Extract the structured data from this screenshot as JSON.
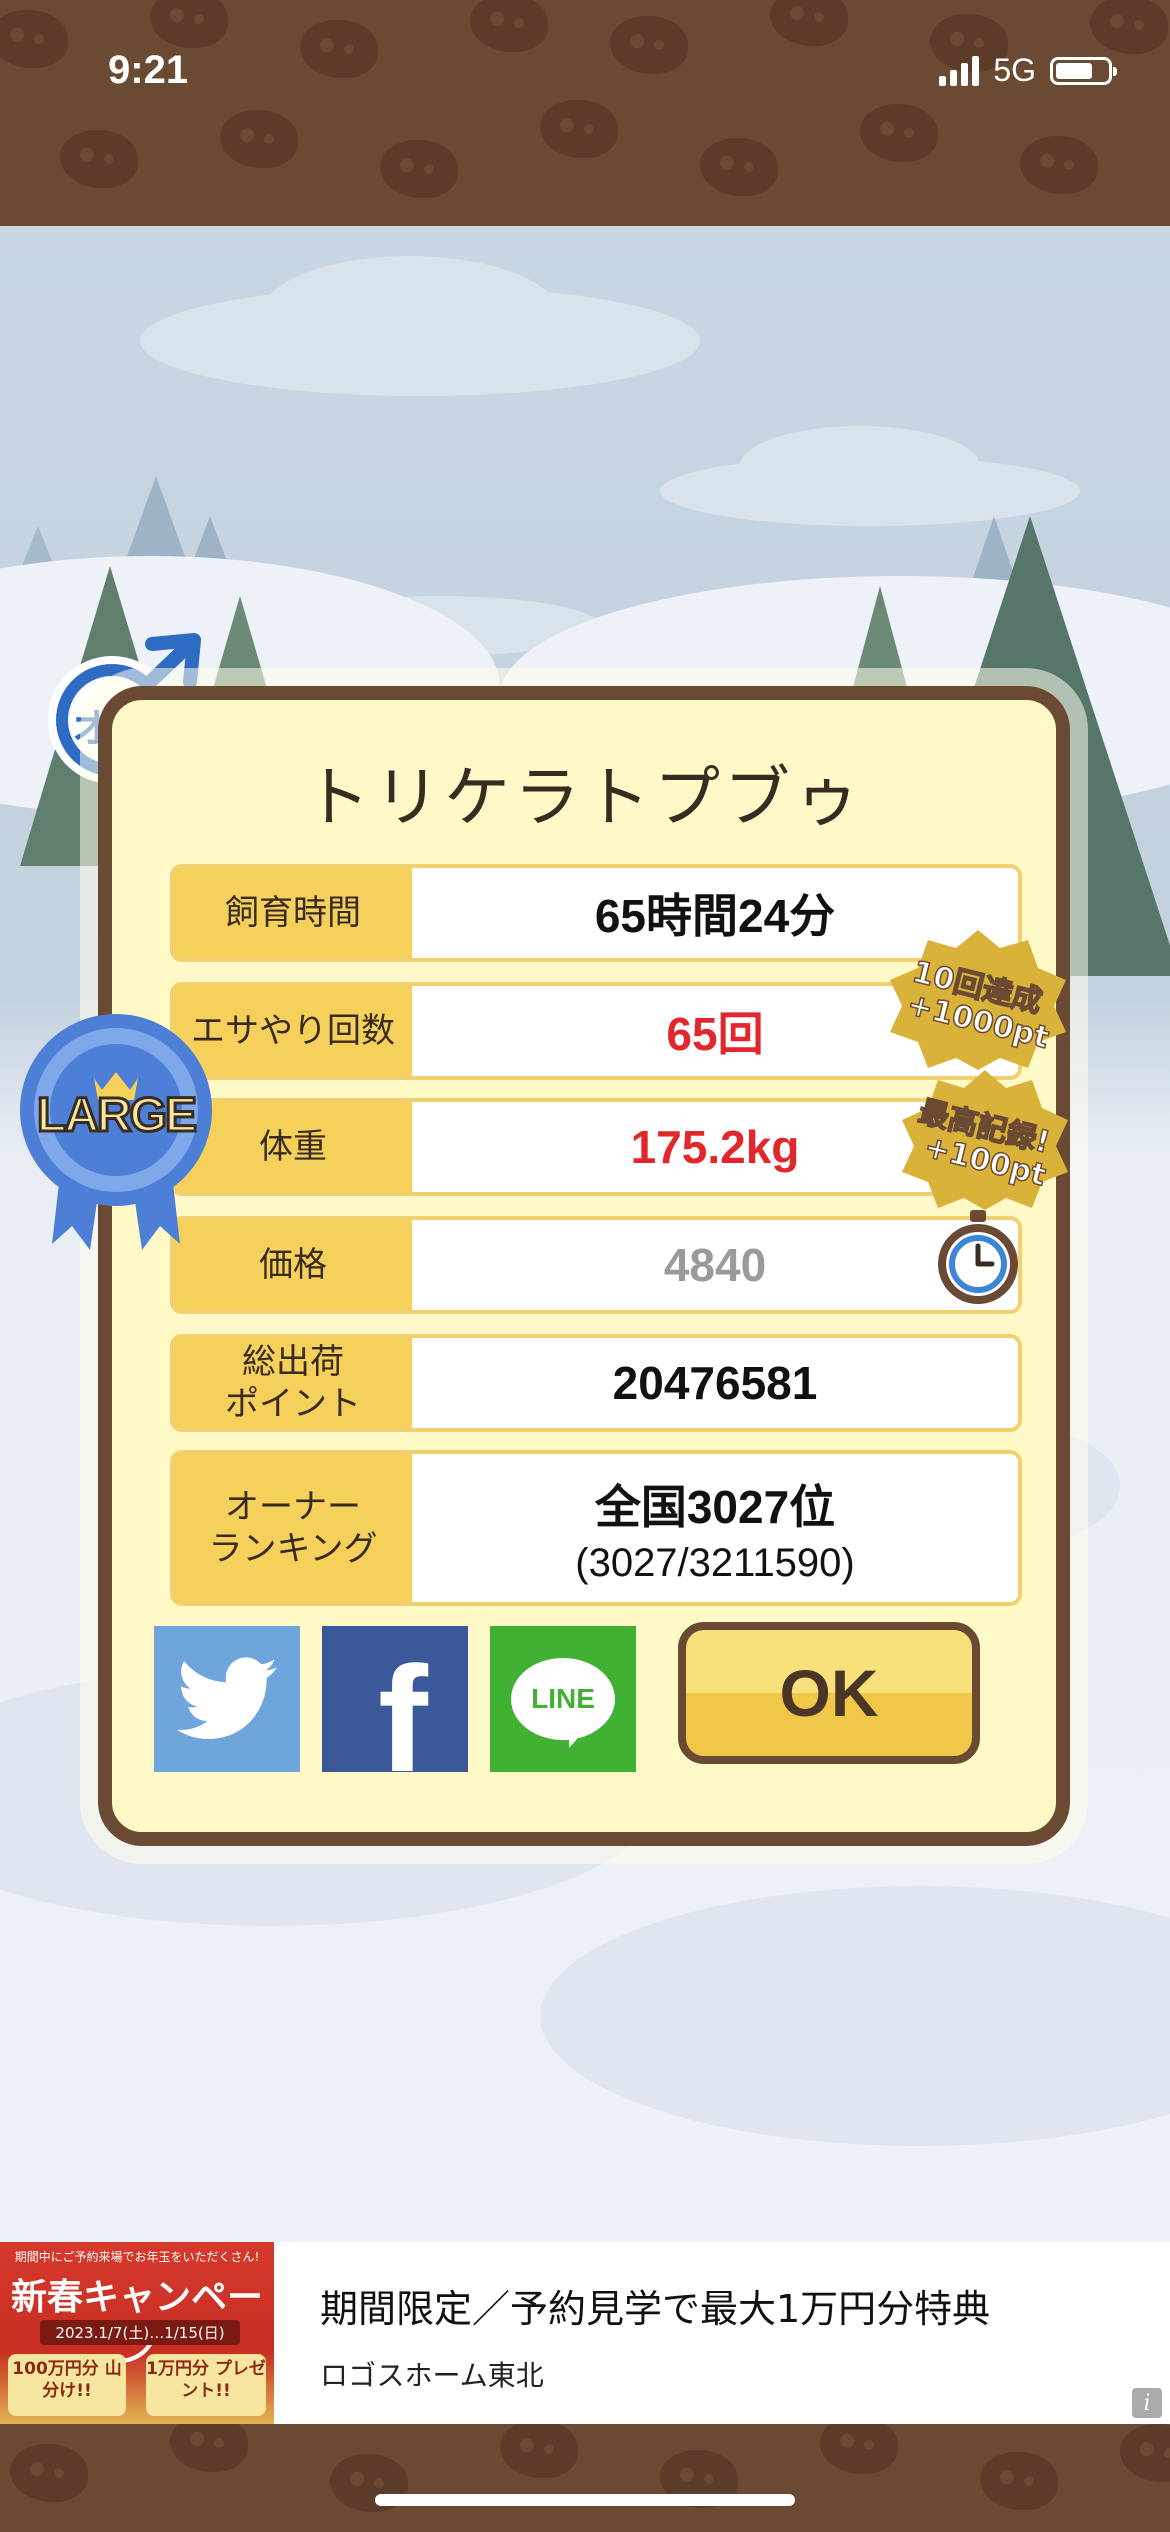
{
  "status_bar": {
    "time": "9:21",
    "network": "5G"
  },
  "card": {
    "title": "トリケラトプブゥ",
    "gender_badge": "オス",
    "size_ribbon": "LARGE",
    "rows": [
      {
        "label": "飼育時間",
        "value": "65時間24分",
        "value_color": "#111111"
      },
      {
        "label": "エサやり回数",
        "value": "65回",
        "value_color": "#e3262b"
      },
      {
        "label": "体重",
        "value": "175.2kg",
        "value_color": "#e3262b"
      },
      {
        "label": "価格",
        "value": "4840",
        "value_color": "#9a9a9a"
      },
      {
        "label": "総出荷\nポイント",
        "value": "20476581",
        "value_color": "#111111"
      },
      {
        "label": "オーナー\nランキング",
        "value": "全国3027位",
        "sub": "(3027/3211590)",
        "value_color": "#111111"
      }
    ],
    "badges": [
      {
        "line1": "10回達成",
        "line2": "+1000pt"
      },
      {
        "line1": "最高記録!",
        "line2": "+100pt"
      }
    ],
    "share": {
      "twitter_color": "#6ea6dc",
      "facebook_color": "#3b5998",
      "line_color": "#40b133",
      "line_label": "LINE"
    },
    "ok_label": "OK"
  },
  "ad": {
    "image_headline": "新春キャンペーン",
    "image_topline": "期間中にご予約来場でお年玉をいただくさん!",
    "image_dates": "2023.1/7(土)…1/15(日)",
    "image_offer1": "100万円分 山分け!!",
    "image_offer2": "1万円分 プレゼント!!",
    "title": "期間限定／予約見学で最大1万円分特典",
    "advertiser": "ロゴスホーム東北",
    "info_icon": "i"
  }
}
